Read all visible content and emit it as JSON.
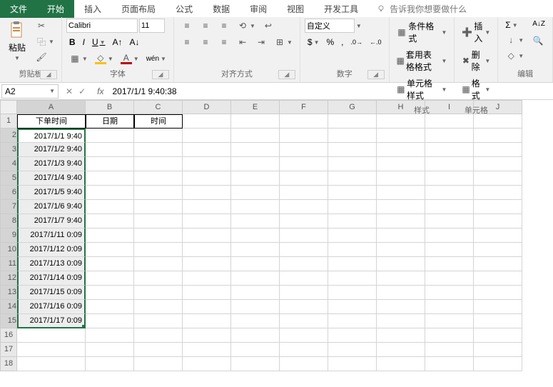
{
  "tabs": {
    "file": "文件",
    "home": "开始",
    "insert": "插入",
    "layout": "页面布局",
    "formulas": "公式",
    "data": "数据",
    "review": "审阅",
    "view": "视图",
    "dev": "开发工具",
    "tellme": "告诉我你想要做什么"
  },
  "ribbon": {
    "clipboard": {
      "label": "剪贴板",
      "paste": "粘贴"
    },
    "font": {
      "label": "字体",
      "name": "Calibri",
      "size": "11",
      "bold": "B",
      "italic": "I",
      "underline": "U"
    },
    "align": {
      "label": "对齐方式"
    },
    "number": {
      "label": "数字",
      "format": "自定义"
    },
    "styles": {
      "label": "样式",
      "cond": "条件格式",
      "table": "套用表格格式",
      "cell": "单元格样式"
    },
    "cells": {
      "label": "单元格",
      "insert": "插入",
      "delete": "删除",
      "format": "格式"
    },
    "editing": {
      "label": "编辑"
    }
  },
  "formula_bar": {
    "name_box": "A2",
    "formula": "2017/1/1 9:40:38"
  },
  "columns": [
    "A",
    "B",
    "C",
    "D",
    "E",
    "F",
    "G",
    "H",
    "I",
    "J"
  ],
  "headers": {
    "A": "下单时间",
    "B": "日期",
    "C": "时间"
  },
  "rows": [
    {
      "n": 1
    },
    {
      "n": 2,
      "A": "2017/1/1 9:40"
    },
    {
      "n": 3,
      "A": "2017/1/2 9:40"
    },
    {
      "n": 4,
      "A": "2017/1/3 9:40"
    },
    {
      "n": 5,
      "A": "2017/1/4 9:40"
    },
    {
      "n": 6,
      "A": "2017/1/5 9:40"
    },
    {
      "n": 7,
      "A": "2017/1/6 9:40"
    },
    {
      "n": 8,
      "A": "2017/1/7 9:40"
    },
    {
      "n": 9,
      "A": "2017/1/11 0:09"
    },
    {
      "n": 10,
      "A": "2017/1/12 0:09"
    },
    {
      "n": 11,
      "A": "2017/1/13 0:09"
    },
    {
      "n": 12,
      "A": "2017/1/14 0:09"
    },
    {
      "n": 13,
      "A": "2017/1/15 0:09"
    },
    {
      "n": 14,
      "A": "2017/1/16 0:09"
    },
    {
      "n": 15,
      "A": "2017/1/17 0:09"
    },
    {
      "n": 16
    },
    {
      "n": 17
    },
    {
      "n": 18
    }
  ]
}
